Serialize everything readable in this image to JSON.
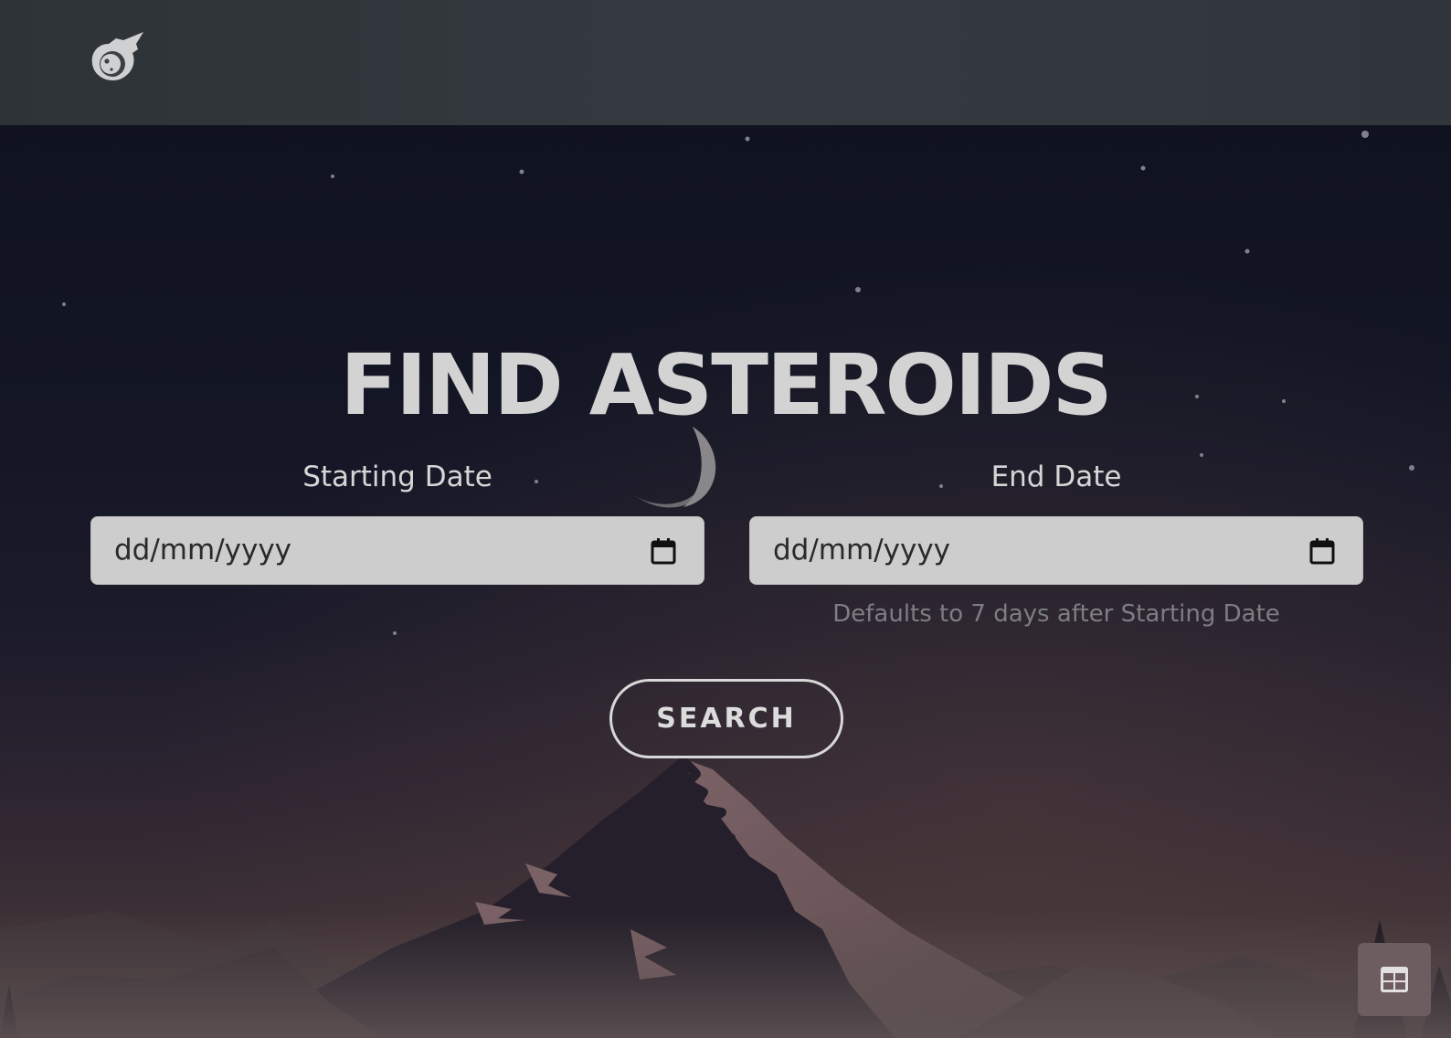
{
  "header": {
    "logo_icon": "meteor-icon"
  },
  "hero": {
    "title": "FIND ASTEROIDS"
  },
  "form": {
    "start_label": "Starting Date",
    "start_value": "dd/mm/yyyy",
    "end_label": "End Date",
    "end_value": "dd/mm/yyyy",
    "end_helper": "Defaults to 7 days after Starting Date",
    "calendar_icon": "calendar-icon",
    "search_label": "SEARCH"
  },
  "floating_button": {
    "icon": "table-icon"
  },
  "colors": {
    "header_bg": "#343a40",
    "input_bg": "#cdcdcd",
    "title": "#d3d3d3",
    "helper_text": "#7d7d84",
    "floating_button_bg": "#6d5d60"
  }
}
